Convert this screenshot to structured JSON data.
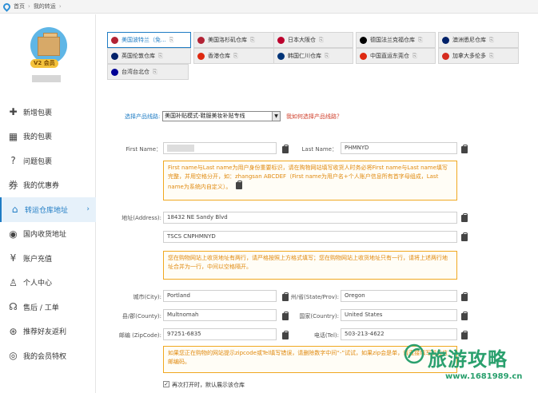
{
  "breadcrumb": {
    "home": "首页",
    "current": "我的转运"
  },
  "user": {
    "vip_level": "V2",
    "vip_label": "会员"
  },
  "menu": [
    {
      "icon": "plus-icon",
      "glyph": "✚",
      "label": "新增包裹"
    },
    {
      "icon": "package-icon",
      "glyph": "▦",
      "label": "我的包裹"
    },
    {
      "icon": "question-icon",
      "glyph": "?",
      "label": "问题包裹"
    },
    {
      "icon": "coupon-icon",
      "glyph": "券",
      "label": "我的优惠券"
    },
    {
      "icon": "home-icon",
      "glyph": "⌂",
      "label": "转运仓库地址",
      "active": true
    },
    {
      "icon": "location-pin-icon",
      "glyph": "◉",
      "label": "国内收货地址"
    },
    {
      "icon": "yen-icon",
      "glyph": "¥",
      "label": "账户充值"
    },
    {
      "icon": "person-icon",
      "glyph": "♙",
      "label": "个人中心"
    },
    {
      "icon": "headset-icon",
      "glyph": "☊",
      "label": "售后 / 工单"
    },
    {
      "icon": "share-icon",
      "glyph": "⊛",
      "label": "推荐好友返利"
    },
    {
      "icon": "member-icon",
      "glyph": "◎",
      "label": "我的会员特权"
    }
  ],
  "tabs": [
    {
      "label": "美国波特兰（免...",
      "flag": "us",
      "active": true
    },
    {
      "label": "美国洛杉矶仓库",
      "flag": "us"
    },
    {
      "label": "日本大阪仓",
      "flag": "jp"
    },
    {
      "label": "德国法兰克福仓库",
      "flag": "de"
    },
    {
      "label": "澳洲悉尼仓库",
      "flag": "au"
    },
    {
      "label": "英国伦敦仓库",
      "flag": "uk"
    },
    {
      "label": "香港仓库",
      "flag": "hk"
    },
    {
      "label": "韩国仁川仓库",
      "flag": "kr"
    },
    {
      "label": "中国直运东莞仓",
      "flag": "cn"
    },
    {
      "label": "加拿大多伦多",
      "flag": "ca"
    },
    {
      "label": "台湾台北仓",
      "flag": "tw"
    }
  ],
  "tab_copy_glyph": "⎘",
  "form": {
    "line_label": "选择产品线路:",
    "line_value": "美国补贴模式-鞋服美妆补贴专线",
    "line_help": "我如何选择产品线路？",
    "first_name_label": "First Name：",
    "last_name_label": "Last Name：",
    "last_name_value": "PHMNYD",
    "name_note": "First name与Last name为用户身份重要标识，请在购物网站填写收货人时务必将First name与Last name填写完整，并用空格分开，如：zhangsan ABCDEF（First name为用户名+个人账户信息所有首字母组成，Last name为系统内自定义）。",
    "address_label": "地址(Address):",
    "address1_value": "18432 NE Sandy Blvd",
    "address2_value": "TSCS CNPHMNYD",
    "address_note": "您在购物网站上收货地址有两行，请严格按照上方格式填写；您在购物网站上收货地址只有一行，请将上述两行地址合并为一行，中间以空格隔开。",
    "city_label": "城市(City):",
    "city_value": "Portland",
    "state_label": "州/省(State/Prov):",
    "state_value": "Oregon",
    "county_label": "县/郡(County):",
    "county_value": "Multnomah",
    "country_label": "国家(Country):",
    "country_value": "United States",
    "zip_label": "邮编 (ZipCode):",
    "zip_value": "97251-6835",
    "tel_label": "电话(Tel):",
    "tel_value": "503-213-4622",
    "zip_note": "如果您正在购物的网站提示zipcode或Tel填写错误，请删除数字中间“-”试试，如果zip会是单，请直接填写前五位邮编码。",
    "checkbox_label": "再次打开时，默认展示该仓库"
  },
  "watermark": {
    "title": "旅游攻略",
    "url": "www.1681989.cn"
  },
  "colors": {
    "accent": "#1f7cc4",
    "warning": "#f0a820",
    "link_red": "#d0402c",
    "watermark": "#2aa06e"
  }
}
